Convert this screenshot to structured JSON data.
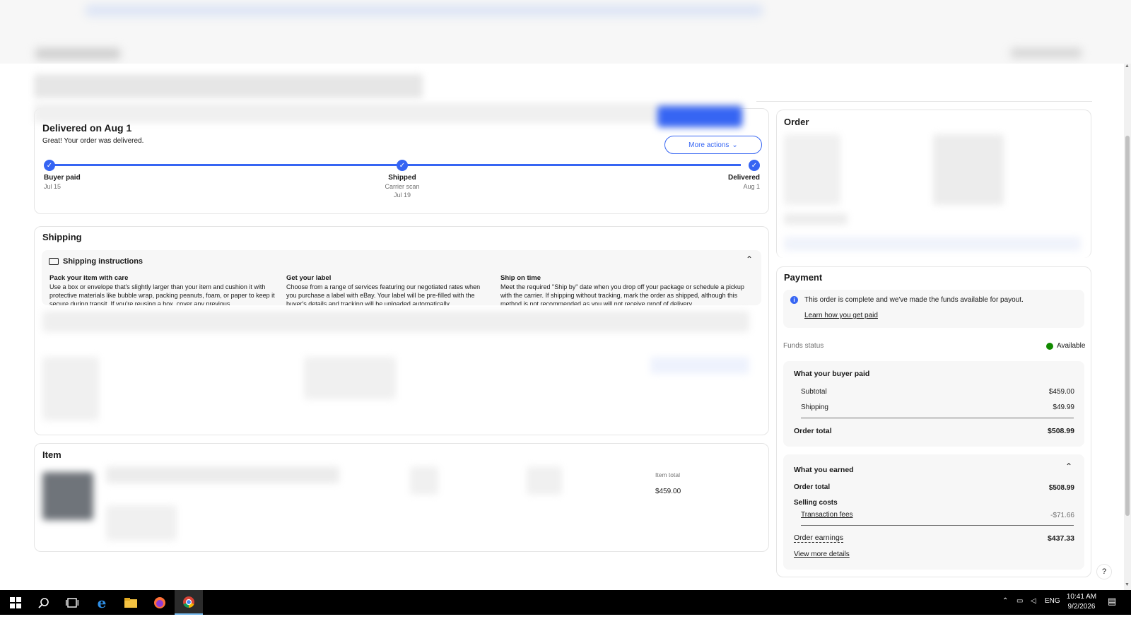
{
  "status": {
    "title": "Delivered on Aug 1",
    "subtitle": "Great! Your order was delivered.",
    "more_actions_label": "More actions",
    "steps": [
      {
        "label": "Buyer paid",
        "sub": "",
        "date": "Jul 15"
      },
      {
        "label": "Shipped",
        "sub": "Carrier scan",
        "date": "Jul 19"
      },
      {
        "label": "Delivered",
        "sub": "",
        "date": "Aug 1"
      }
    ]
  },
  "shipping": {
    "title": "Shipping",
    "instructions_title": "Shipping instructions",
    "columns": [
      {
        "title": "Pack your item with care",
        "text": "Use a box or envelope that's slightly larger than your item and cushion it with protective materials like bubble wrap, packing peanuts, foam, or paper to keep it secure during transit. If you're reusing a box, cover any previous"
      },
      {
        "title": "Get your label",
        "text": "Choose from a range of services featuring our negotiated rates when you purchase a label with eBay. Your label will be pre-filled with the buyer's details and tracking will be uploaded automatically."
      },
      {
        "title": "Ship on time",
        "text": "Meet the required \"Ship by\" date when you drop off your package or schedule a pickup with the carrier. If shipping without tracking, mark the order as shipped, although this method is not recommended as you will not receive proof of delivery."
      }
    ]
  },
  "item": {
    "title": "Item",
    "total_label": "Item total",
    "total_value": "$459.00"
  },
  "order": {
    "title": "Order"
  },
  "payment": {
    "title": "Payment",
    "info_text": "This order is complete and we've made the funds available for payout.",
    "info_link": "Learn how you get paid",
    "funds_status_label": "Funds status",
    "funds_status_value": "Available",
    "buyer_paid": {
      "title": "What your buyer paid",
      "subtotal_label": "Subtotal",
      "subtotal_value": "$459.00",
      "shipping_label": "Shipping",
      "shipping_value": "$49.99",
      "order_total_label": "Order total",
      "order_total_value": "$508.99"
    },
    "earned": {
      "title": "What you earned",
      "order_total_label": "Order total",
      "order_total_value": "$508.99",
      "selling_costs_label": "Selling costs",
      "fees_label": "Transaction fees",
      "fees_value": "-$71.66",
      "earnings_label": "Order earnings",
      "earnings_value": "$437.33",
      "details_link": "View more details"
    }
  },
  "help": {
    "label": "?"
  },
  "taskbar": {
    "lang": "ENG",
    "time": "10:41 AM",
    "date": "9/2/2026"
  }
}
